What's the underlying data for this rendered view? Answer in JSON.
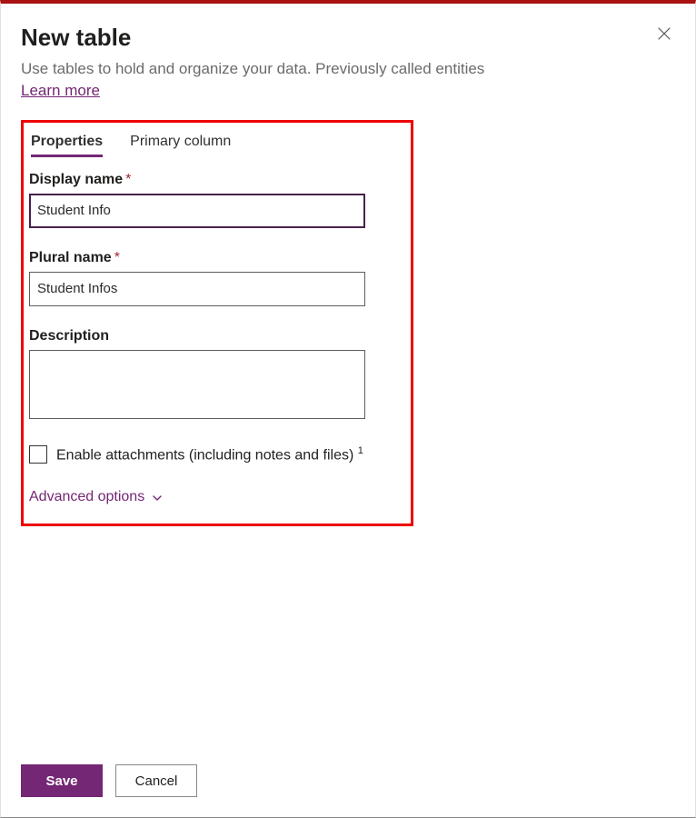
{
  "panel": {
    "title": "New table",
    "subtitle": "Use tables to hold and organize your data. Previously called entities",
    "learn_more": "Learn more"
  },
  "tabs": {
    "properties": "Properties",
    "primary_column": "Primary column"
  },
  "fields": {
    "display_name": {
      "label": "Display name",
      "value": "Student Info"
    },
    "plural_name": {
      "label": "Plural name",
      "value": "Student Infos"
    },
    "description": {
      "label": "Description",
      "value": ""
    },
    "enable_attachments": {
      "label": "Enable attachments (including notes and files)",
      "checked": false
    }
  },
  "advanced_options": "Advanced options",
  "buttons": {
    "save": "Save",
    "cancel": "Cancel"
  },
  "required_marker": "*",
  "footnote_marker": "1"
}
